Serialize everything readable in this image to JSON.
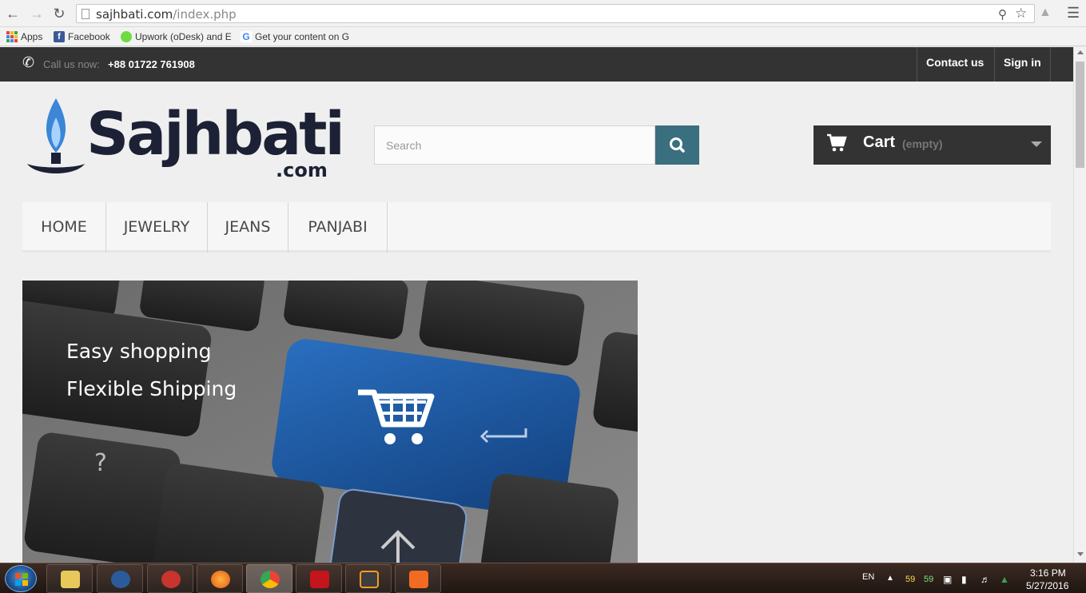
{
  "browser": {
    "url_host": "sajhbati.com",
    "url_path": "/index.php",
    "bookmarks": [
      {
        "label": "Apps"
      },
      {
        "label": "Facebook"
      },
      {
        "label": "Upwork (oDesk) and E"
      },
      {
        "label": "Get your content on G"
      }
    ]
  },
  "site": {
    "topbar": {
      "call_label": "Call us now:",
      "call_number": "+88 01722 761908",
      "contact_label": "Contact us",
      "signin_label": "Sign in"
    },
    "logo": {
      "name": "Sajhbati",
      "suffix": ".com"
    },
    "search": {
      "placeholder": "Search"
    },
    "cart": {
      "label": "Cart",
      "status": "(empty)"
    },
    "menu": [
      "HOME",
      "JEWELRY",
      "JEANS",
      "PANJABI"
    ],
    "banner": {
      "line1": "Easy shopping",
      "line2": "Flexible Shipping"
    }
  },
  "taskbar": {
    "lang": "EN",
    "temp1": "59",
    "temp2": "59",
    "time": "3:16 PM",
    "date": "5/27/2016"
  },
  "colors": {
    "topbar": "#333333",
    "search_button": "#3a6f7f",
    "cart": "#333333",
    "logo_dark": "#1c2135",
    "flame_blue": "#3b86d6"
  }
}
